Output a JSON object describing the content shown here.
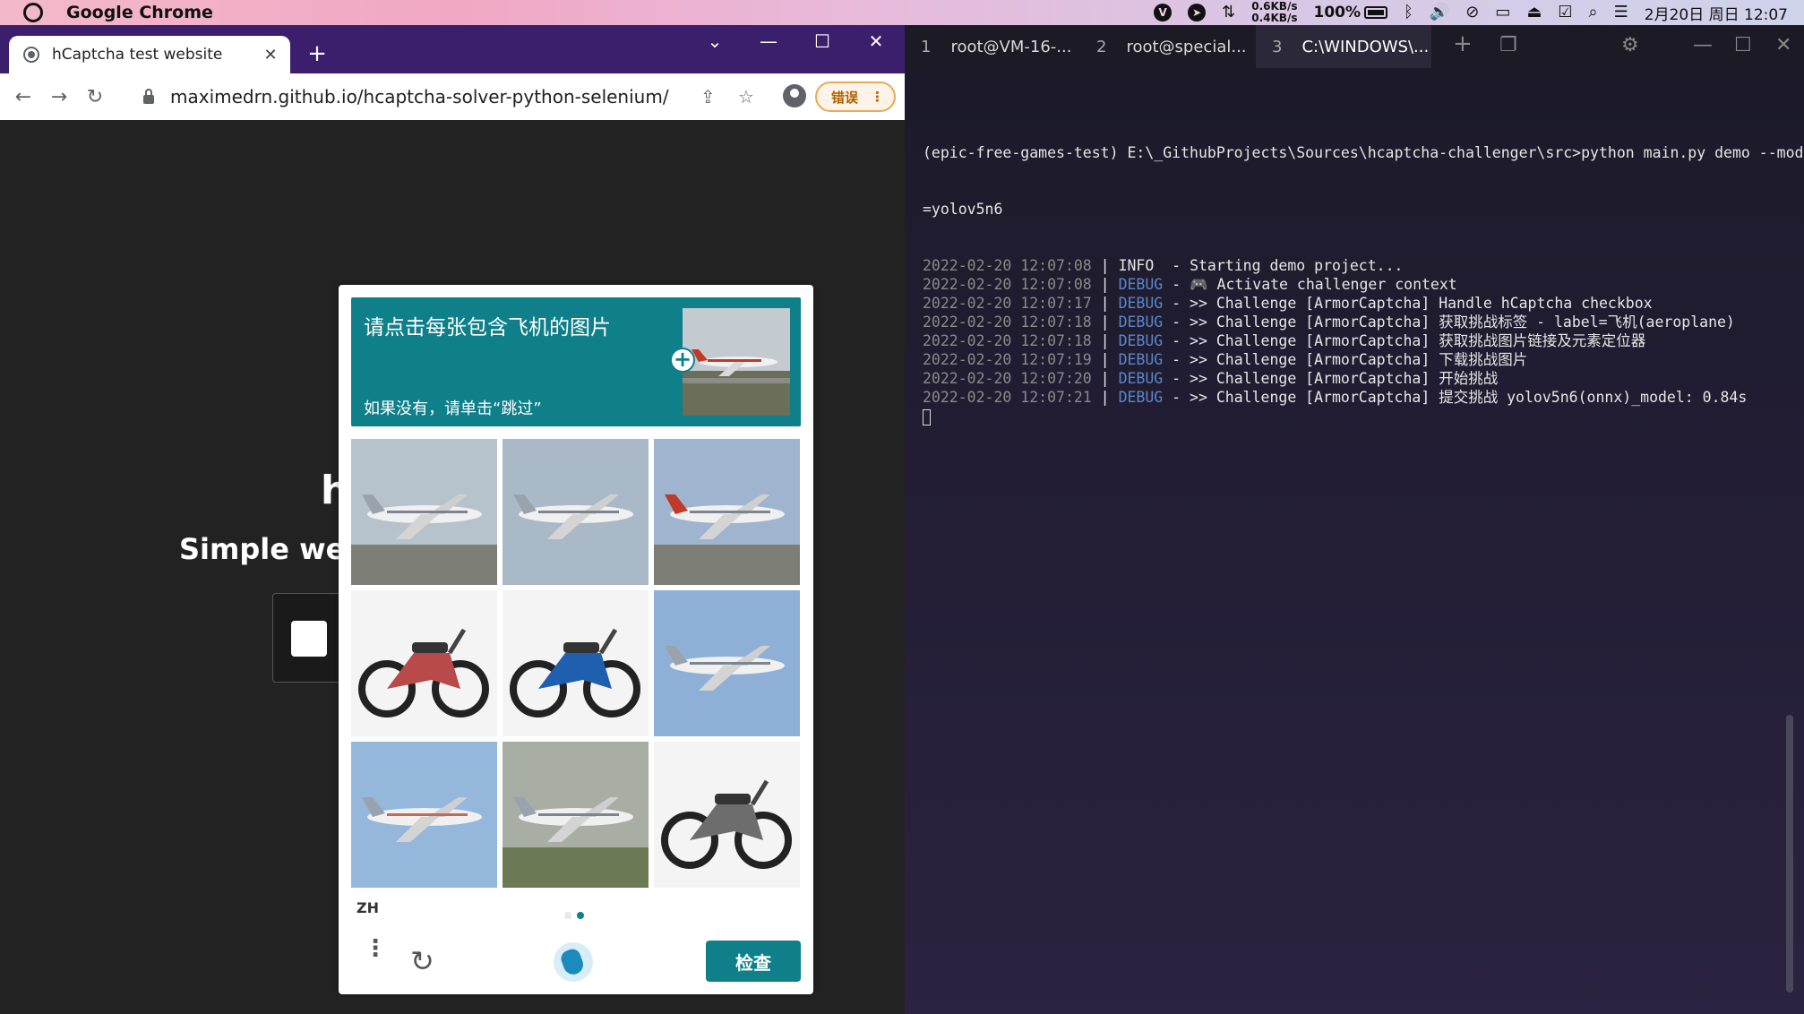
{
  "menubar": {
    "app_name": "Google Chrome",
    "net_up": "0.6KB/s",
    "net_down": "0.4KB/s",
    "battery": "100%",
    "clock": "2月20日 周日 12:07"
  },
  "chrome": {
    "tab_title": "hCaptcha test website",
    "url": "maximedrn.github.io/hcaptcha-solver-python-selenium/",
    "error_pill": "错误"
  },
  "page": {
    "heading_fragment": "h",
    "subtitle_fragment": "Simple webs"
  },
  "captcha": {
    "prompt_title": "请点击每张包含飞机的图片",
    "prompt_hint": "如果没有，请单击“跳过”",
    "language": "ZH",
    "check_label": "检查",
    "images": [
      {
        "label": "aeroplane",
        "kind": "jet"
      },
      {
        "label": "aeroplane",
        "kind": "plane"
      },
      {
        "label": "aeroplane",
        "kind": "plane"
      },
      {
        "label": "motorcycle",
        "kind": "moto"
      },
      {
        "label": "motorcycle",
        "kind": "sportbike"
      },
      {
        "label": "aeroplane",
        "kind": "plane"
      },
      {
        "label": "aeroplane",
        "kind": "plane"
      },
      {
        "label": "aeroplane",
        "kind": "plane"
      },
      {
        "label": "motorcycle",
        "kind": "moto"
      }
    ],
    "pages": 2,
    "current_page": 2
  },
  "terminal": {
    "tabs": [
      {
        "num": "1",
        "label": "root@VM-16-..."
      },
      {
        "num": "2",
        "label": "root@special..."
      },
      {
        "num": "3",
        "label": "C:\\WINDOWS\\..."
      }
    ],
    "command": "(epic-free-games-test) E:\\_GithubProjects\\Sources\\hcaptcha-challenger\\src>python main.py demo --model",
    "command_wrap": "=yolov5n6",
    "logs": [
      {
        "ts": "2022-02-20 12:07:08",
        "level": "INFO",
        "msg": "Starting demo project..."
      },
      {
        "ts": "2022-02-20 12:07:08",
        "level": "DEBUG",
        "msg": "🎮 Activate challenger context"
      },
      {
        "ts": "2022-02-20 12:07:17",
        "level": "DEBUG",
        "msg": ">> Challenge [ArmorCaptcha] Handle hCaptcha checkbox"
      },
      {
        "ts": "2022-02-20 12:07:18",
        "level": "DEBUG",
        "msg": ">> Challenge [ArmorCaptcha] 获取挑战标签 - label=飞机(aeroplane)"
      },
      {
        "ts": "2022-02-20 12:07:18",
        "level": "DEBUG",
        "msg": ">> Challenge [ArmorCaptcha] 获取挑战图片链接及元素定位器"
      },
      {
        "ts": "2022-02-20 12:07:19",
        "level": "DEBUG",
        "msg": ">> Challenge [ArmorCaptcha] 下载挑战图片"
      },
      {
        "ts": "2022-02-20 12:07:20",
        "level": "DEBUG",
        "msg": ">> Challenge [ArmorCaptcha] 开始挑战"
      },
      {
        "ts": "2022-02-20 12:07:21",
        "level": "DEBUG",
        "msg": ">> Challenge [ArmorCaptcha] 提交挑战 yolov5n6(onnx)_model: 0.84s"
      }
    ]
  }
}
